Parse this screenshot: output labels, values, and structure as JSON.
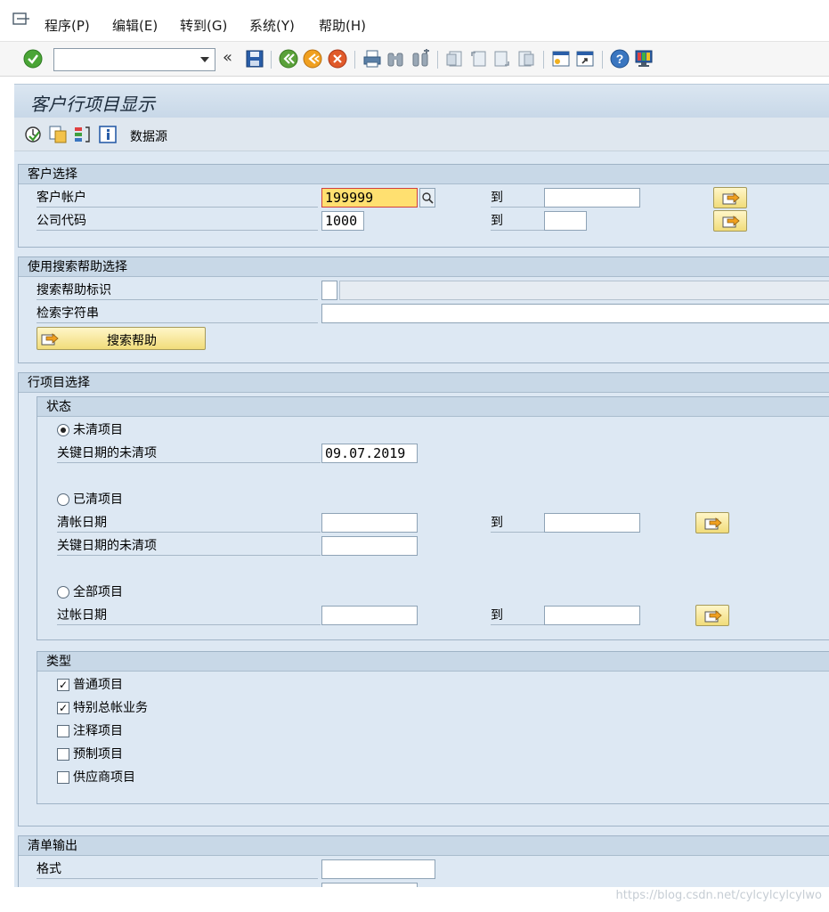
{
  "menu": {
    "items": [
      "程序(P)",
      "编辑(E)",
      "转到(G)",
      "系统(Y)",
      "帮助(H)"
    ]
  },
  "toolbar": {
    "command_value": "",
    "collapse_glyph": "«"
  },
  "title": "客户行项目显示",
  "app_toolbar": {
    "data_source_label": "数据源"
  },
  "customer_selection": {
    "title": "客户选择",
    "rows": [
      {
        "label": "客户帐户",
        "from": "199999",
        "to_label": "到",
        "to": ""
      },
      {
        "label": "公司代码",
        "from": "1000",
        "to_label": "到",
        "to": ""
      }
    ]
  },
  "search_help": {
    "title": "使用搜索帮助选择",
    "id_label": "搜索帮助标识",
    "id_value": "",
    "desc_value": "",
    "string_label": "检索字符串",
    "string_value": "",
    "button_label": "搜索帮助"
  },
  "line_items": {
    "title": "行项目选择",
    "status": {
      "title": "状态",
      "open_label": "未清项目",
      "open_selected": true,
      "open_key_date_label": "关键日期的未清项",
      "open_key_date": "09.07.2019",
      "cleared_label": "已清项目",
      "cleared_selected": false,
      "clearing_date_label": "清帐日期",
      "to_label": "到",
      "clearing_from": "",
      "clearing_to": "",
      "cleared_key_date_label": "关键日期的未清项",
      "cleared_key_date": "",
      "all_label": "全部项目",
      "all_selected": false,
      "posting_date_label": "过帐日期",
      "posting_from": "",
      "posting_to": ""
    },
    "type": {
      "title": "类型",
      "options": [
        {
          "label": "普通项目",
          "checked": true
        },
        {
          "label": "特别总帐业务",
          "checked": true
        },
        {
          "label": "注释项目",
          "checked": false
        },
        {
          "label": "预制项目",
          "checked": false
        },
        {
          "label": "供应商项目",
          "checked": false
        }
      ]
    }
  },
  "list_output": {
    "title": "清单输出",
    "format_label": "格式",
    "format_value": ""
  },
  "watermark": "https://blog.csdn.net/cylcylcylcylwo",
  "colors": {
    "canvas": "#dde8f3",
    "group_header": "#c8d8e7",
    "focus_field": "#ffe070",
    "button": "#f1dc7a"
  }
}
